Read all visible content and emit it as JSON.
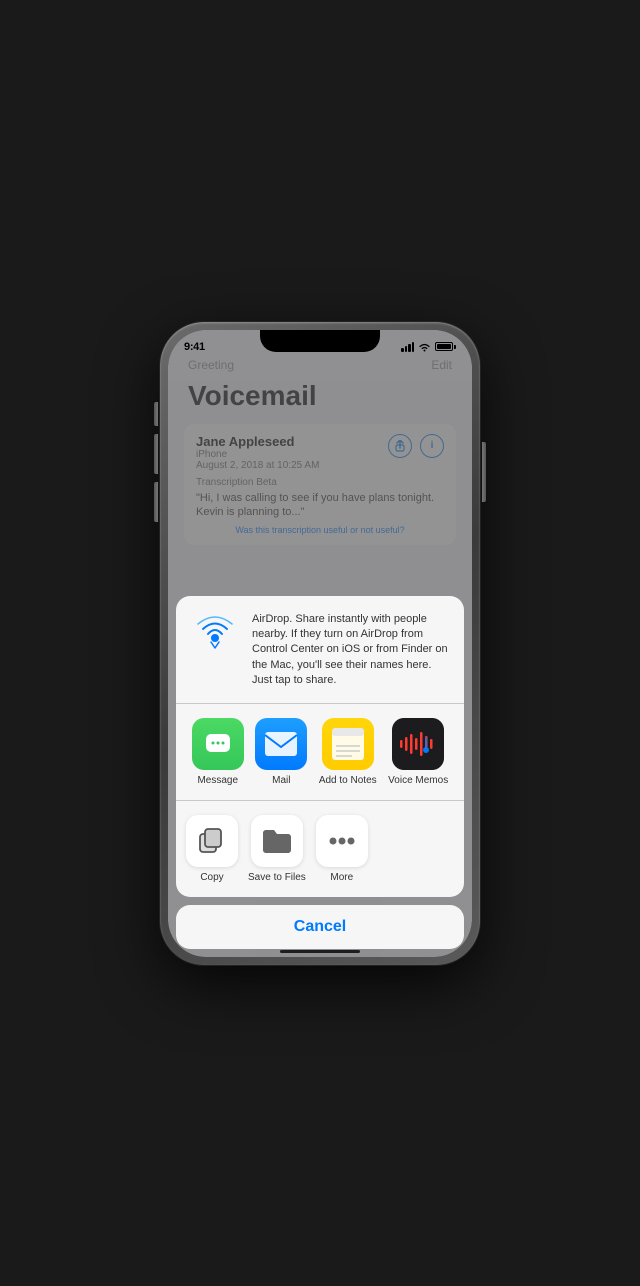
{
  "status": {
    "time": "9:41"
  },
  "app": {
    "nav_left": "Greeting",
    "nav_right": "Edit",
    "title": "Voicemail",
    "contact_name": "Jane Appleseed",
    "contact_source": "iPhone",
    "contact_date": "August 2, 2018 at 10:25 AM",
    "transcript_label": "Transcription Beta",
    "transcript_text": "\"Hi, I was calling to see if you have plans tonight. Kevin is planning to...\"",
    "feedback_pre": "Was this transcription ",
    "feedback_useful": "useful",
    "feedback_or": " or ",
    "feedback_not_useful": "not useful",
    "feedback_post": "?"
  },
  "share_sheet": {
    "airdrop_description": "AirDrop. Share instantly with people nearby. If they turn on AirDrop from Control Center on iOS or from Finder on the Mac, you'll see their names here. Just tap to share.",
    "apps": [
      {
        "label": "Message",
        "id": "messages"
      },
      {
        "label": "Mail",
        "id": "mail"
      },
      {
        "label": "Add to Notes",
        "id": "notes"
      },
      {
        "label": "Voice Memos",
        "id": "voicememos"
      }
    ],
    "actions": [
      {
        "label": "Copy",
        "id": "copy"
      },
      {
        "label": "Save to Files",
        "id": "files"
      },
      {
        "label": "More",
        "id": "more"
      }
    ],
    "cancel_label": "Cancel"
  }
}
